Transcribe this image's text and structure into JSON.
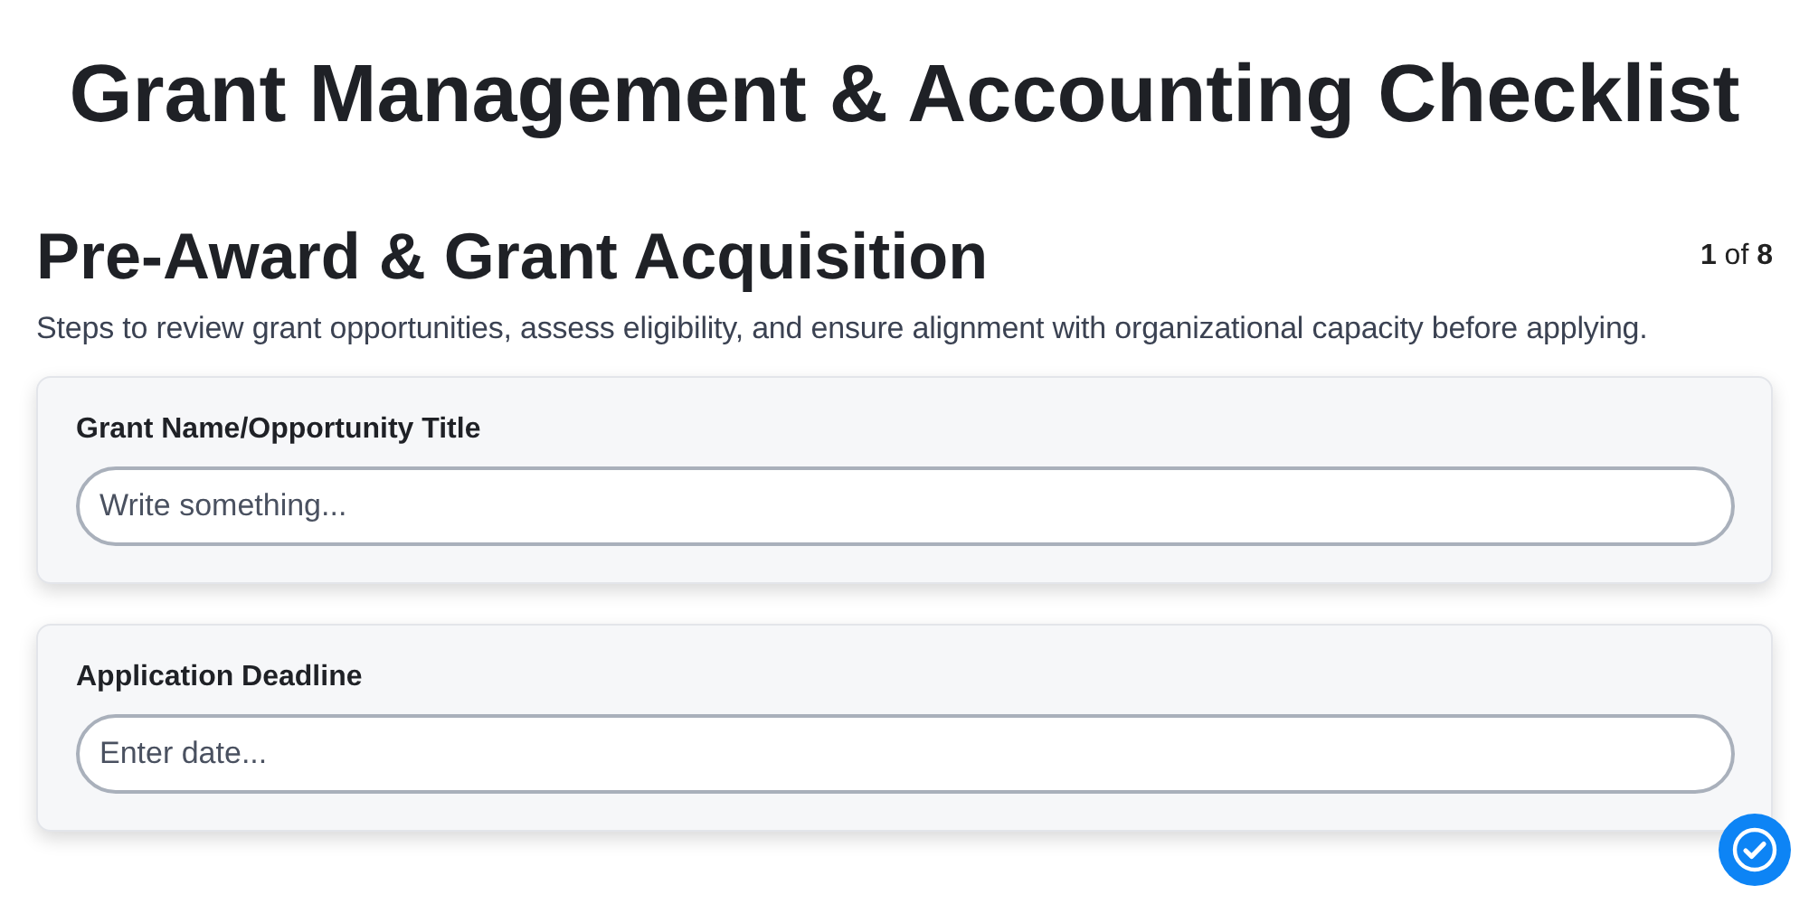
{
  "title": "Grant Management & Accounting Checklist",
  "section": {
    "heading": "Pre-Award & Grant Acquisition",
    "counter": "**1** of **8**",
    "description": "Steps to review grant opportunities, assess eligibility, and ensure alignment with organizational capacity before applying."
  },
  "fields": [
    {
      "label": "Grant Name/Opportunity Title",
      "placeholder": "Write something..."
    },
    {
      "label": "Application Deadline",
      "placeholder": "Enter date..."
    }
  ]
}
